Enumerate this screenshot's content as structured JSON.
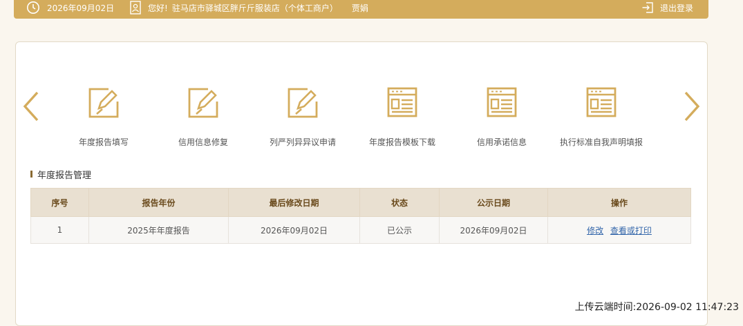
{
  "header": {
    "date": "2026年09月02日",
    "greeting": "您好!",
    "company": "驻马店市驿城区胖斤斤服装店（个体工商户）",
    "user": "贾娟",
    "logout_label": "退出登录"
  },
  "functions": [
    {
      "label": "年度报告填写",
      "icon": "edit-icon"
    },
    {
      "label": "信用信息修复",
      "icon": "edit-icon"
    },
    {
      "label": "列严列异异议申请",
      "icon": "edit-icon"
    },
    {
      "label": "年度报告模板下载",
      "icon": "form-icon"
    },
    {
      "label": "信用承诺信息",
      "icon": "form-icon"
    },
    {
      "label": "执行标准自我声明填报",
      "icon": "form-icon"
    }
  ],
  "section": {
    "title": "年度报告管理"
  },
  "table": {
    "headers": [
      "序号",
      "报告年份",
      "最后修改日期",
      "状态",
      "公示日期",
      "操作"
    ],
    "rows": [
      {
        "index": "1",
        "year": "2025年年度报告",
        "modified": "2026年09月02日",
        "status": "已公示",
        "publish": "2026年09月02日",
        "edit": "修改",
        "view": "查看或打印"
      }
    ]
  },
  "footer": {
    "upload_time": "上传云端时间:2026-09-02 11:47:23"
  },
  "colors": {
    "accent": "#d4ac5c",
    "header_bg": "#e9e0d1",
    "link": "#3366aa"
  }
}
